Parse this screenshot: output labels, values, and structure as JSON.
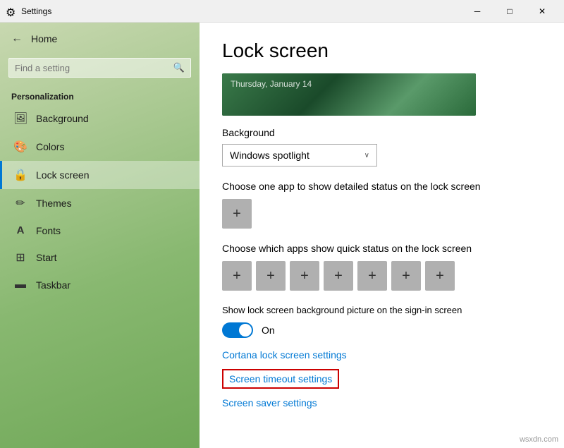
{
  "titleBar": {
    "title": "Settings",
    "minimizeLabel": "─",
    "maximizeLabel": "□",
    "closeLabel": "✕"
  },
  "sidebar": {
    "homeLabel": "Home",
    "searchPlaceholder": "Find a setting",
    "sectionLabel": "Personalization",
    "items": [
      {
        "id": "background",
        "label": "Background",
        "icon": "🖼"
      },
      {
        "id": "colors",
        "label": "Colors",
        "icon": "🎨"
      },
      {
        "id": "lock-screen",
        "label": "Lock screen",
        "icon": "🔒"
      },
      {
        "id": "themes",
        "label": "Themes",
        "icon": "✏"
      },
      {
        "id": "fonts",
        "label": "Fonts",
        "icon": "A"
      },
      {
        "id": "start",
        "label": "Start",
        "icon": "⊞"
      },
      {
        "id": "taskbar",
        "label": "Taskbar",
        "icon": "▬"
      }
    ]
  },
  "content": {
    "pageTitle": "Lock screen",
    "previewText": "Thursday, January 14",
    "backgroundLabel": "Background",
    "dropdownValue": "Windows spotlight",
    "detailedStatusText": "Choose one app to show detailed status on the lock screen",
    "quickStatusText": "Choose which apps show quick status on the lock screen",
    "signInLabel": "Show lock screen background picture on the sign-in screen",
    "toggleState": "On",
    "links": [
      {
        "id": "cortana",
        "label": "Cortana lock screen settings",
        "highlighted": false
      },
      {
        "id": "screen-timeout",
        "label": "Screen timeout settings",
        "highlighted": true
      },
      {
        "id": "screen-saver",
        "label": "Screen saver settings",
        "highlighted": false
      }
    ]
  },
  "watermark": "wsxdn.com"
}
